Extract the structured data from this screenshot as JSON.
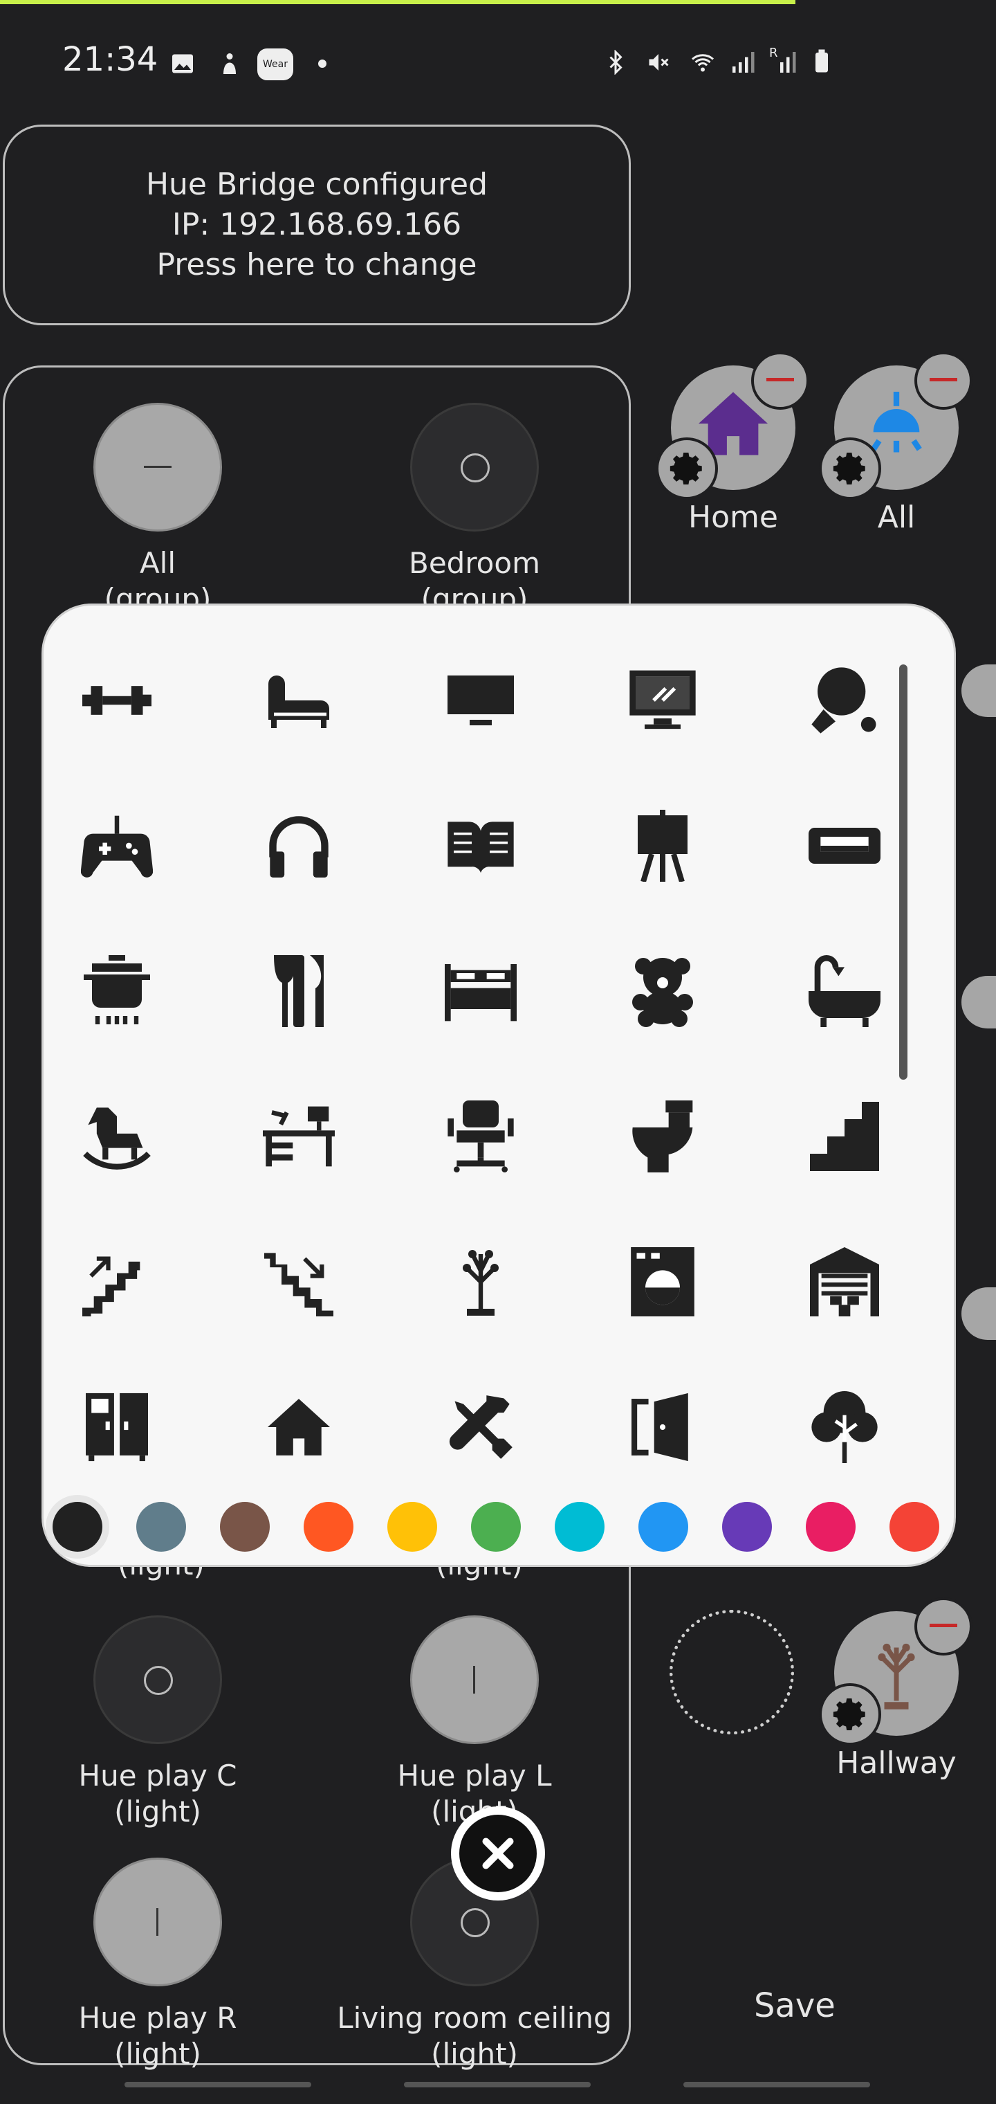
{
  "status_bar": {
    "time": "21:34",
    "left_icons": [
      "gallery-icon",
      "notification-person-icon",
      "wear-icon",
      "dot-icon"
    ],
    "wear_label": "Wear",
    "right_icons": [
      "bluetooth-icon",
      "mute-icon",
      "wifi-icon",
      "signal-icon",
      "signal-roaming-icon",
      "battery-icon"
    ],
    "roaming_label": "R"
  },
  "bridge": {
    "line1": "Hue Bridge configured",
    "line2": "IP: 192.168.69.166",
    "line3": "Press here to change"
  },
  "lights": [
    {
      "name": "All",
      "type": "(group)",
      "state": "on"
    },
    {
      "name": "Bedroom",
      "type": "(group)",
      "state": "off"
    },
    {
      "name": "Hue play C",
      "type": "(light)",
      "state": "off"
    },
    {
      "name": "Hue play L",
      "type": "(light)",
      "state": "on"
    },
    {
      "name": "Hue play R",
      "type": "(light)",
      "state": "on"
    },
    {
      "name": "Living room ceiling",
      "type": "(light)",
      "state": "off"
    }
  ],
  "hidden_partial_labels": {
    "left": "(light)",
    "right": "(light)"
  },
  "rooms": [
    {
      "label": "Home",
      "icon": "house-icon",
      "color": "#5b2d8e"
    },
    {
      "label": "All",
      "icon": "ceiling-lamp-icon",
      "color": "#1e88e5"
    },
    {
      "label": "Hallway",
      "icon": "coat-rack-icon",
      "color": "#795548"
    }
  ],
  "picker": {
    "icons": [
      "dumbbell-icon",
      "chaise-lounge-icon",
      "tv-icon",
      "monitor-icon",
      "ping-pong-icon",
      "gamepad-icon",
      "headphones-icon",
      "open-book-icon",
      "easel-icon",
      "sofa-icon",
      "cooking-pot-icon",
      "cutlery-icon",
      "bed-icon",
      "teddy-bear-icon",
      "bathtub-icon",
      "rocking-horse-icon",
      "desk-icon",
      "office-chair-icon",
      "toilet-icon",
      "stairs-icon",
      "stairs-up-icon",
      "stairs-down-icon",
      "coat-rack-icon",
      "washing-machine-icon",
      "garage-icon",
      "wardrobe-icon",
      "house-icon",
      "tools-icon",
      "door-icon",
      "tree-icon"
    ],
    "colors": [
      "#212121",
      "#607d8b",
      "#795548",
      "#ff5722",
      "#ffc107",
      "#4caf50",
      "#00bcd4",
      "#2196f3",
      "#673ab7",
      "#e91e63",
      "#f44336"
    ],
    "selected_color": "#212121"
  },
  "save_label": "Save"
}
